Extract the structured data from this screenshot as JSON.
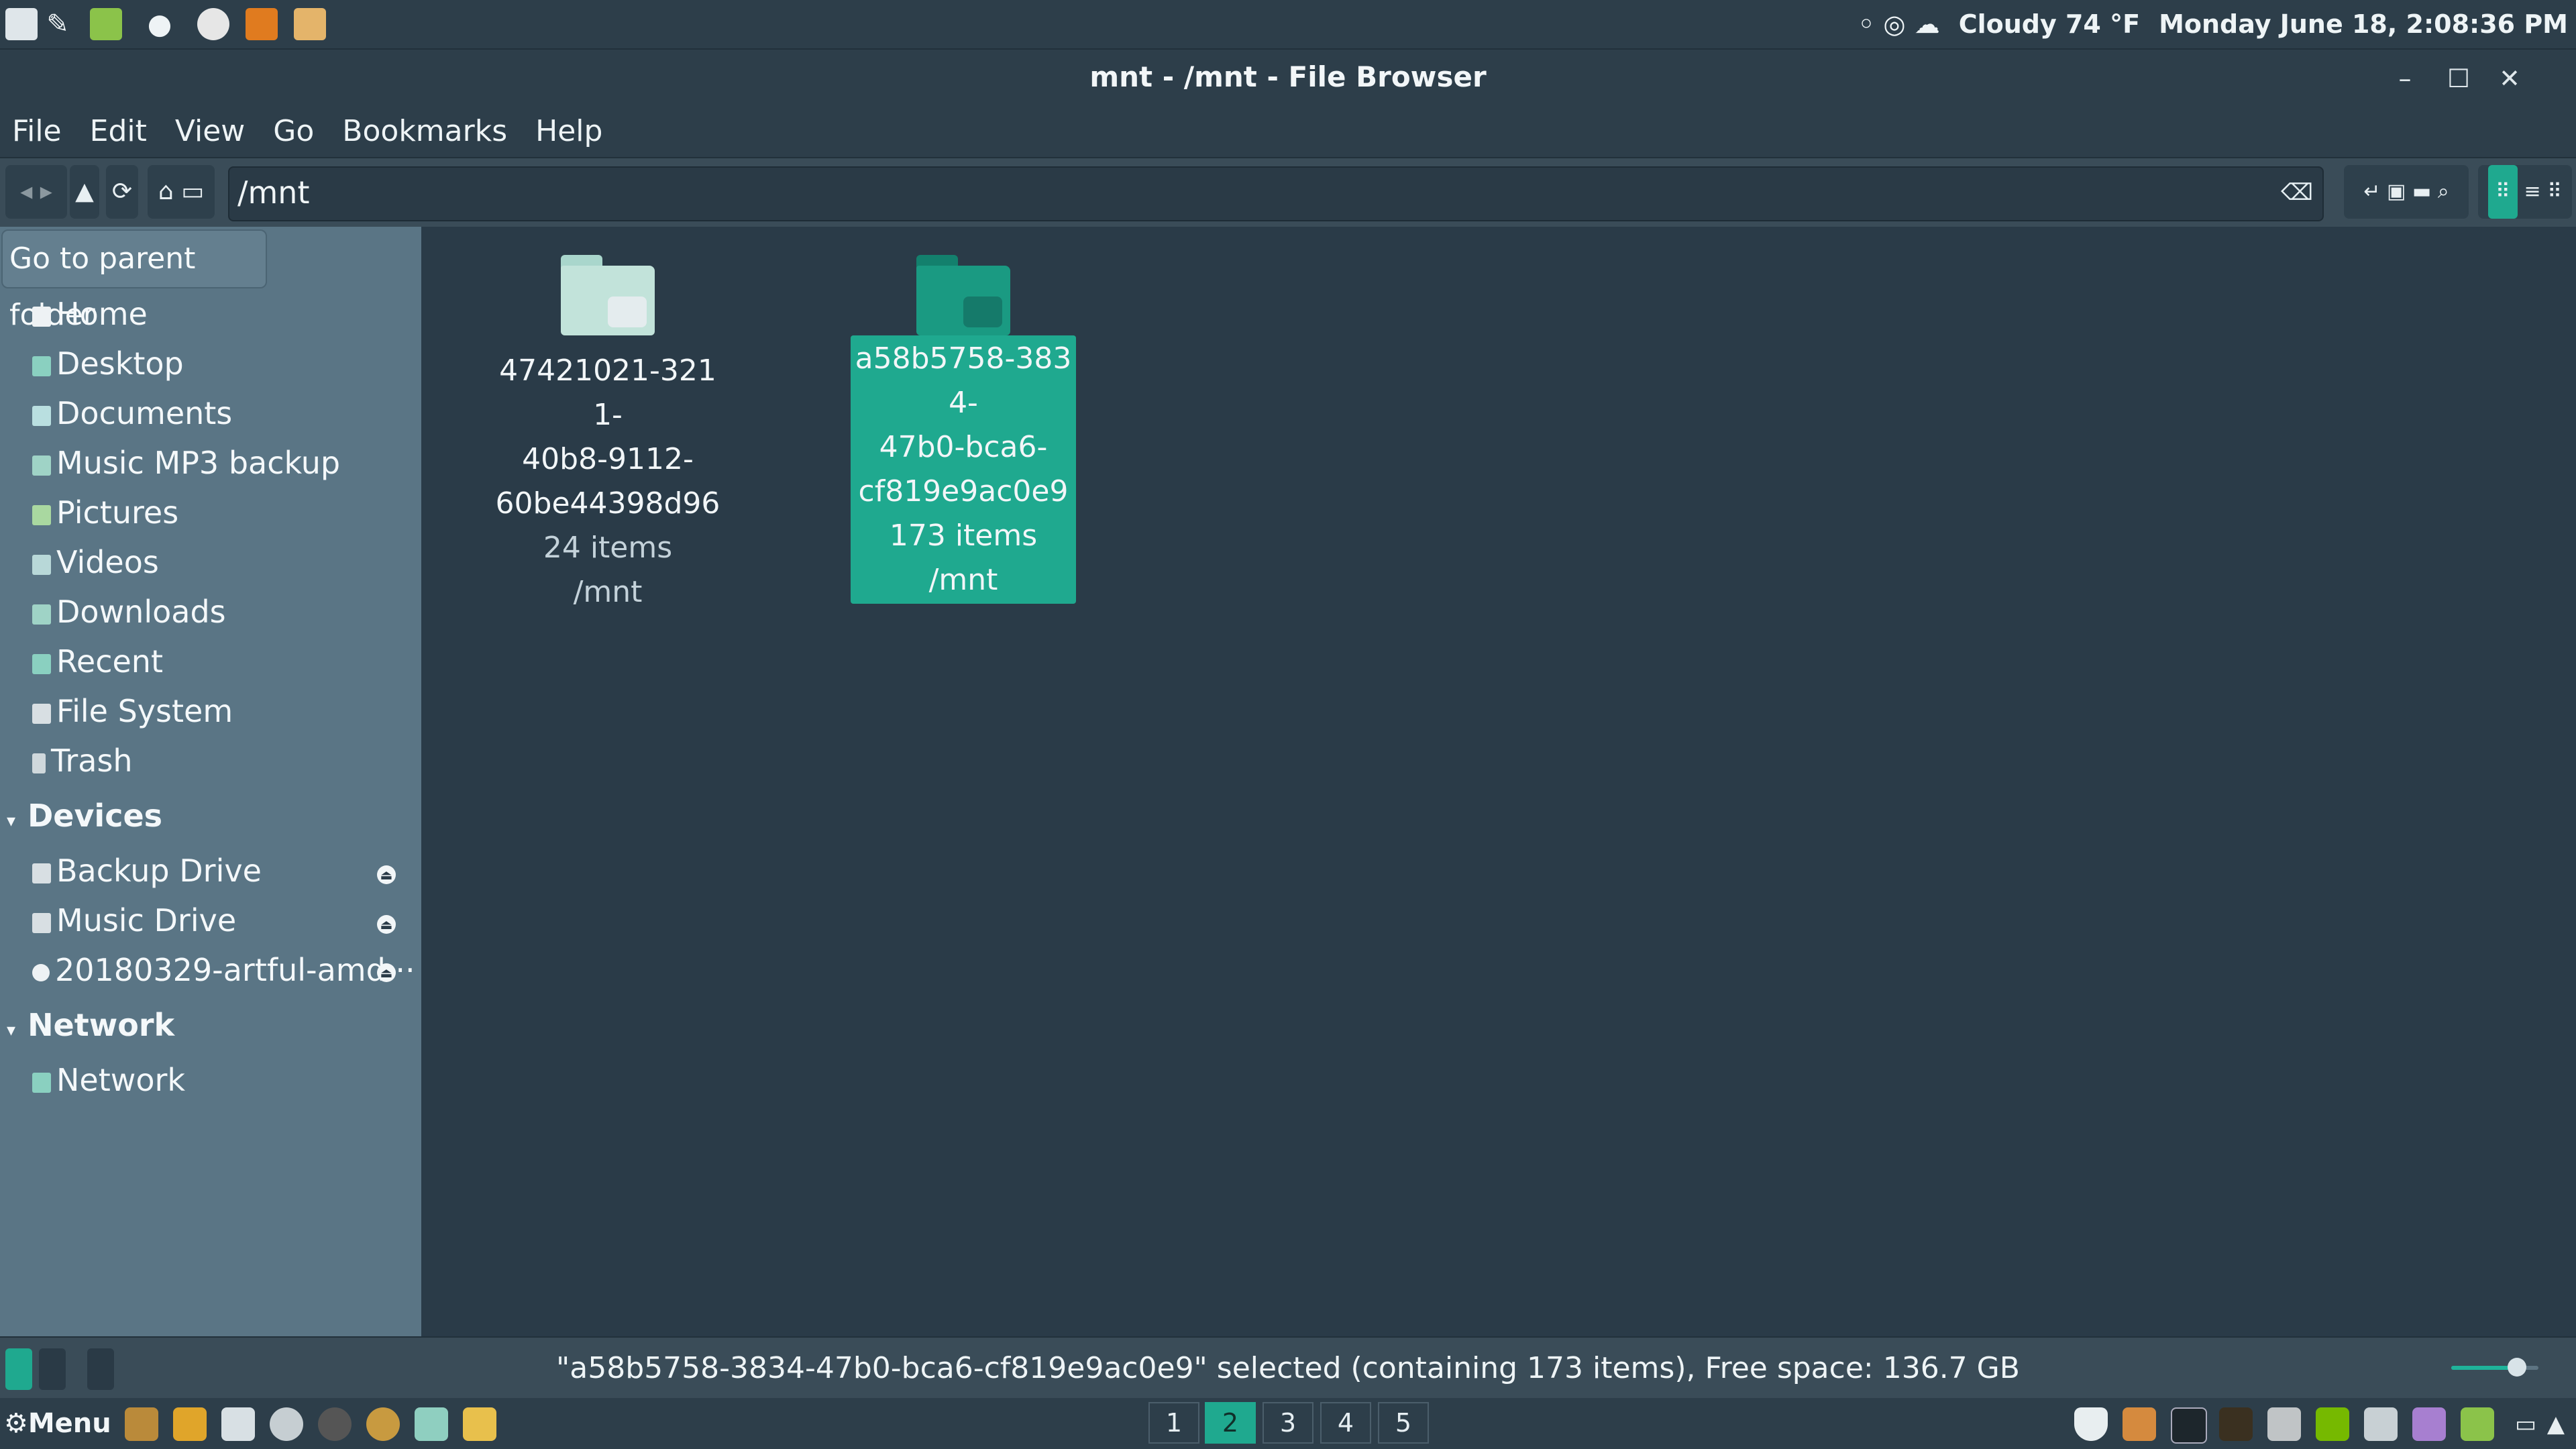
{
  "top_panel": {
    "weather": "Cloudy 74 °F",
    "datetime": "Monday June 18,  2:08:36 PM"
  },
  "window": {
    "title": "mnt - /mnt - File Browser",
    "minimize_icon": "minimize-icon",
    "maximize_icon": "maximize-icon",
    "close_icon": "close-icon"
  },
  "menubar": [
    "File",
    "Edit",
    "View",
    "Go",
    "Bookmarks",
    "Help"
  ],
  "toolbar": {
    "location": "/mnt",
    "icons": [
      "back-icon",
      "forward-icon",
      "up-icon",
      "reload-icon",
      "home-icon",
      "computer-icon",
      "breadcrumb-toggle-icon",
      "terminal-icon",
      "new-folder-icon",
      "search-icon",
      "icon-view-icon",
      "list-view-icon",
      "compact-view-icon"
    ]
  },
  "tooltip": "Go to parent folder",
  "sidebar": {
    "places": [
      "Home",
      "Desktop",
      "Documents",
      "Music MP3 backup",
      "Pictures",
      "Videos",
      "Downloads",
      "Recent",
      "File System",
      "Trash"
    ],
    "devices_header": "Devices",
    "devices": [
      "Backup Drive",
      "Music Drive",
      "20180329-artful-amd···"
    ],
    "network_header": "Network",
    "network": [
      "Network"
    ]
  },
  "files": [
    {
      "name_lines": [
        "47421021-3211-",
        "40b8-9112-",
        "60be44398d96"
      ],
      "items": "24 items",
      "location": "/mnt",
      "selected": false
    },
    {
      "name_lines": [
        "a58b5758-3834-",
        "47b0-bca6-",
        "cf819e9ac0e9"
      ],
      "items": "173 items",
      "location": "/mnt",
      "selected": true
    }
  ],
  "statusbar": {
    "text": "\"a58b5758-3834-47b0-bca6-cf819e9ac0e9\" selected (containing 173 items), Free space: 136.7 GB",
    "zoom_fraction": 0.75
  },
  "bottom_panel": {
    "menu_label": "Menu",
    "workspaces": [
      "1",
      "2",
      "3",
      "4",
      "5"
    ],
    "active_workspace": "2"
  },
  "colors": {
    "accent": "#1fa98f",
    "sidebar": "#5a7585",
    "background": "#2a3b48"
  }
}
